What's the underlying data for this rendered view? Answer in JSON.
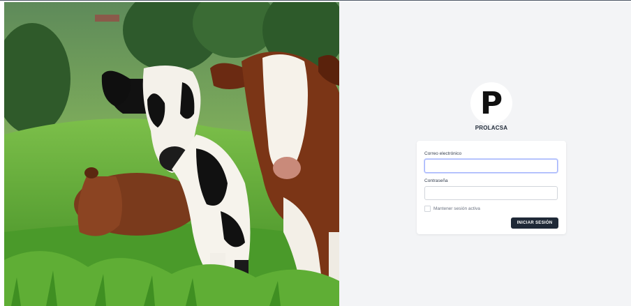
{
  "brand": {
    "name": "PROLACSA",
    "logo_letter": "P"
  },
  "login": {
    "email_label": "Correo electrónico",
    "email_value": "",
    "password_label": "Contraseña",
    "password_value": "",
    "remember_label": "Mantener sesión activa",
    "remember_checked": false,
    "submit_label": "INICIAR SESIÓN"
  },
  "hero": {
    "subject": "cows-in-pasture-photo"
  },
  "colors": {
    "page_bg": "#f3f4f6",
    "card_bg": "#ffffff",
    "button_bg": "#1f2937",
    "focus_ring": "#a5b4fc"
  }
}
